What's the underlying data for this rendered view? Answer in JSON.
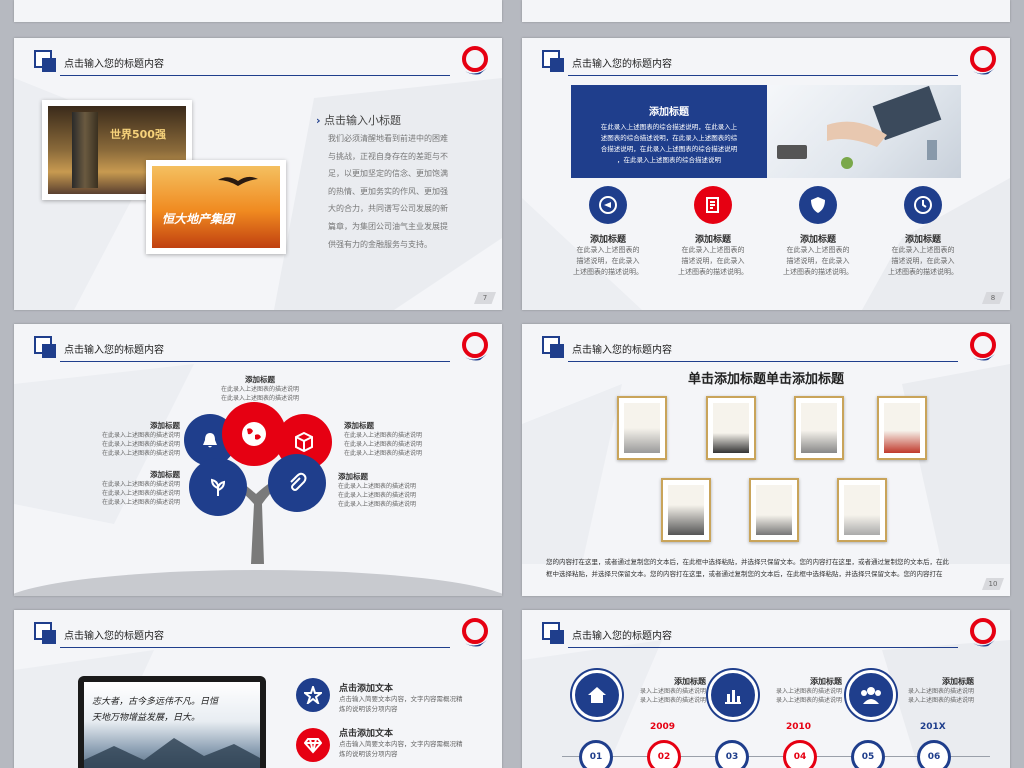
{
  "header_title": "点击输入您的标题内容",
  "colors": {
    "navy": "#1f3e8c",
    "red": "#e60012"
  },
  "slide7": {
    "page": "7",
    "photo1_text": "世界500强",
    "photo2_text": "恒大地产集团",
    "subtitle": "点击输入小标题",
    "body": [
      "我们必须清醒地看到前进中的困难",
      "与挑战，正视自身存在的差距与不",
      "足，以更加坚定的信念、更加饱满",
      "的热情、更加务实的作风、更加强",
      "大的合力，共同谱写公司发展的新",
      "篇章，为集团公司油气主业发展提",
      "供强有力的金融服务与支持。"
    ]
  },
  "slide8": {
    "page": "8",
    "banner_title": "添加标题",
    "banner_body": [
      "在此录入上述图表的综合描述说明，在此录入上",
      "述图表的综合描述说明，在此录入上述图表的综",
      "合描述说明，在此录入上述图表的综合描述说明",
      "，在此录入上述图表的综合描述说明"
    ],
    "items": [
      {
        "icon": "play-icon",
        "title": "添加标题",
        "desc": [
          "在此录入上述图表的",
          "描述说明，在此录入",
          "上述图表的描述说明。"
        ]
      },
      {
        "icon": "document-icon",
        "title": "添加标题",
        "desc": [
          "在此录入上述图表的",
          "描述说明，在此录入",
          "上述图表的描述说明。"
        ]
      },
      {
        "icon": "shield-icon",
        "title": "添加标题",
        "desc": [
          "在此录入上述图表的",
          "描述说明，在此录入",
          "上述图表的描述说明。"
        ]
      },
      {
        "icon": "clock-icon",
        "title": "添加标题",
        "desc": [
          "在此录入上述图表的",
          "描述说明，在此录入",
          "上述图表的描述说明。"
        ]
      }
    ]
  },
  "slide9": {
    "top": {
      "title": "添加标题",
      "desc": [
        "在此录入上述图表的描述说明",
        "在此录入上述图表的描述说明"
      ]
    },
    "left1": {
      "title": "添加标题",
      "desc": [
        "在此录入上述图表的描述说明",
        "在此录入上述图表的描述说明",
        "在此录入上述图表的描述说明"
      ]
    },
    "left2": {
      "title": "添加标题",
      "desc": [
        "在此录入上述图表的描述说明",
        "在此录入上述图表的描述说明",
        "在此录入上述图表的描述说明"
      ]
    },
    "right1": {
      "title": "添加标题",
      "desc": [
        "在此录入上述图表的描述说明",
        "在此录入上述图表的描述说明",
        "在此录入上述图表的描述说明"
      ]
    },
    "right2": {
      "title": "添加标题",
      "desc": [
        "在此录入上述图表的描述说明",
        "在此录入上述图表的描述说明",
        "在此录入上述图表的描述说明"
      ]
    }
  },
  "slide10": {
    "page": "10",
    "main_title": "单击添加标题单击添加标题",
    "footer": [
      "您的内容打在这里，或者通过复制您的文本后，在此框中选择粘贴，并选择只保留文本。您的内容打在这里，或者通过复制您的文本后，在此",
      "框中选择粘贴，并选择只保留文本。您的内容打在这里，或者通过复制您的文本后，在此框中选择粘贴，并选择只保留文本。您的内容打在"
    ]
  },
  "slide11": {
    "calligraphy": [
      "志大者，古今多远伟不凡。日恒",
      "天地万物增益发展，日大。"
    ],
    "items": [
      {
        "icon": "star-icon",
        "title": "点击添加文本",
        "desc": [
          "点击输入简要文本内容，文字内容需概况精",
          "炼的说明该分项内容"
        ]
      },
      {
        "icon": "diamond-icon",
        "title": "点击添加文本",
        "desc": [
          "点击输入简要文本内容，文字内容需概况精",
          "炼的说明该分项内容"
        ]
      }
    ]
  },
  "slide12": {
    "labels": [
      {
        "title": "添加标题",
        "desc": [
          "录入上述图表的描述说明",
          "录入上述图表的描述说明"
        ]
      },
      {
        "title": "添加标题",
        "desc": [
          "录入上述图表的描述说明",
          "录入上述图表的描述说明"
        ]
      },
      {
        "title": "添加标题",
        "desc": [
          "录入上述图表的描述说明",
          "录入上述图表的描述说明"
        ]
      }
    ],
    "years": [
      "2009",
      "2010",
      "201X"
    ],
    "nodes": [
      "01",
      "02",
      "03",
      "04",
      "05",
      "06"
    ]
  }
}
